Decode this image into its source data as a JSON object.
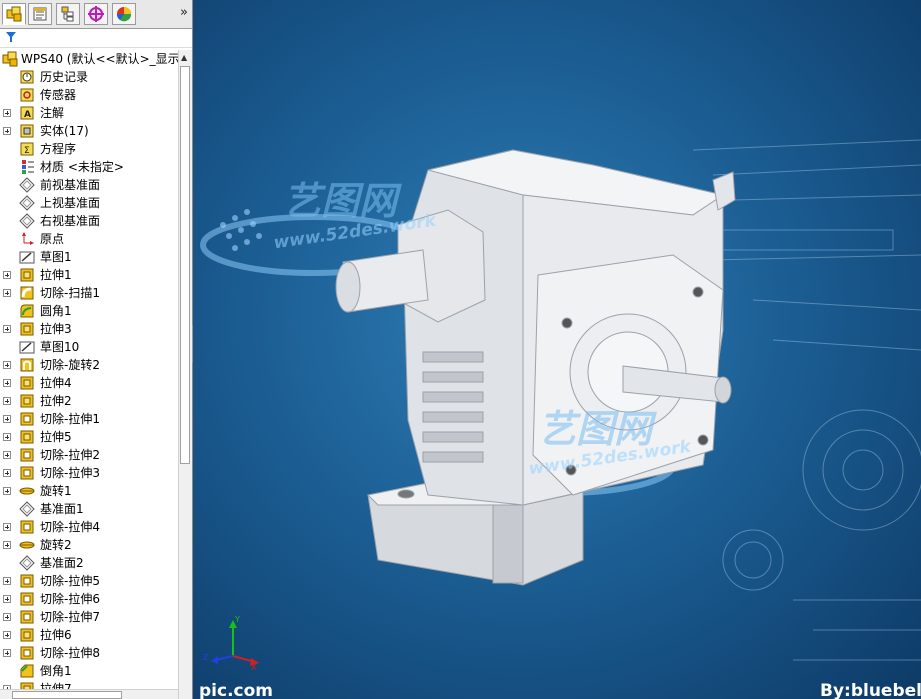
{
  "panel_tabs": [
    {
      "icon": "feature-manager-icon",
      "active": true
    },
    {
      "icon": "property-manager-icon",
      "active": false
    },
    {
      "icon": "configuration-manager-icon",
      "active": false
    },
    {
      "icon": "dimxpert-icon",
      "active": false
    },
    {
      "icon": "display-manager-icon",
      "active": false
    }
  ],
  "tree": {
    "root": "WPS40  (默认<<默认>_显示",
    "items": [
      {
        "label": "历史记录",
        "icon": "history-icon",
        "expander": false
      },
      {
        "label": "传感器",
        "icon": "sensor-icon",
        "expander": false
      },
      {
        "label": "注解",
        "icon": "annotation-icon",
        "expander": true
      },
      {
        "label": "实体(17)",
        "icon": "solid-bodies-icon",
        "expander": true
      },
      {
        "label": "方程序",
        "icon": "equation-icon",
        "expander": false
      },
      {
        "label": "材质 <未指定>",
        "icon": "material-icon",
        "expander": false
      },
      {
        "label": "前视基准面",
        "icon": "plane-icon",
        "expander": false
      },
      {
        "label": "上视基准面",
        "icon": "plane-icon",
        "expander": false
      },
      {
        "label": "右视基准面",
        "icon": "plane-icon",
        "expander": false
      },
      {
        "label": "原点",
        "icon": "origin-icon",
        "expander": false
      },
      {
        "label": "草图1",
        "icon": "sketch-icon",
        "expander": false
      },
      {
        "label": "拉伸1",
        "icon": "extrude-icon",
        "expander": true
      },
      {
        "label": "切除-扫描1",
        "icon": "sweep-cut-icon",
        "expander": true
      },
      {
        "label": "圆角1",
        "icon": "fillet-icon",
        "expander": false
      },
      {
        "label": "拉伸3",
        "icon": "extrude-icon",
        "expander": true
      },
      {
        "label": "草图10",
        "icon": "sketch-icon",
        "expander": false
      },
      {
        "label": "切除-旋转2",
        "icon": "revolve-cut-icon",
        "expander": true
      },
      {
        "label": "拉伸4",
        "icon": "extrude-icon",
        "expander": true
      },
      {
        "label": "拉伸2",
        "icon": "extrude-icon",
        "expander": true
      },
      {
        "label": "切除-拉伸1",
        "icon": "extrude-cut-icon",
        "expander": true
      },
      {
        "label": "拉伸5",
        "icon": "extrude-icon",
        "expander": true
      },
      {
        "label": "切除-拉伸2",
        "icon": "extrude-cut-icon",
        "expander": true
      },
      {
        "label": "切除-拉伸3",
        "icon": "extrude-cut-icon",
        "expander": true
      },
      {
        "label": "旋转1",
        "icon": "revolve-icon",
        "expander": true
      },
      {
        "label": "基准面1",
        "icon": "plane-icon",
        "expander": false
      },
      {
        "label": "切除-拉伸4",
        "icon": "extrude-cut-icon",
        "expander": true
      },
      {
        "label": "旋转2",
        "icon": "revolve-icon",
        "expander": true
      },
      {
        "label": "基准面2",
        "icon": "plane-icon",
        "expander": false
      },
      {
        "label": "切除-拉伸5",
        "icon": "extrude-cut-icon",
        "expander": true
      },
      {
        "label": "切除-拉伸6",
        "icon": "extrude-cut-icon",
        "expander": true
      },
      {
        "label": "切除-拉伸7",
        "icon": "extrude-cut-icon",
        "expander": true
      },
      {
        "label": "拉伸6",
        "icon": "extrude-icon",
        "expander": true
      },
      {
        "label": "切除-拉伸8",
        "icon": "extrude-cut-icon",
        "expander": true
      },
      {
        "label": "倒角1",
        "icon": "chamfer-icon",
        "expander": false
      },
      {
        "label": "拉伸7",
        "icon": "extrude-icon",
        "expander": true
      }
    ]
  },
  "viewport": {
    "watermark_top": "艺图网",
    "watermark_url": "www.52des.work",
    "watermark_bottom": "艺图网",
    "watermark_url_bottom": "www.52des.work",
    "corner_left": "pic.com",
    "corner_right": "By:bluebel",
    "triad_labels": {
      "x": "X",
      "y": "Y",
      "z": "Z"
    }
  },
  "colors": {
    "viewport_bg": "#1c5f95",
    "model": "#e4e6ea",
    "tree_icon_yellow": "#f2d21a"
  }
}
